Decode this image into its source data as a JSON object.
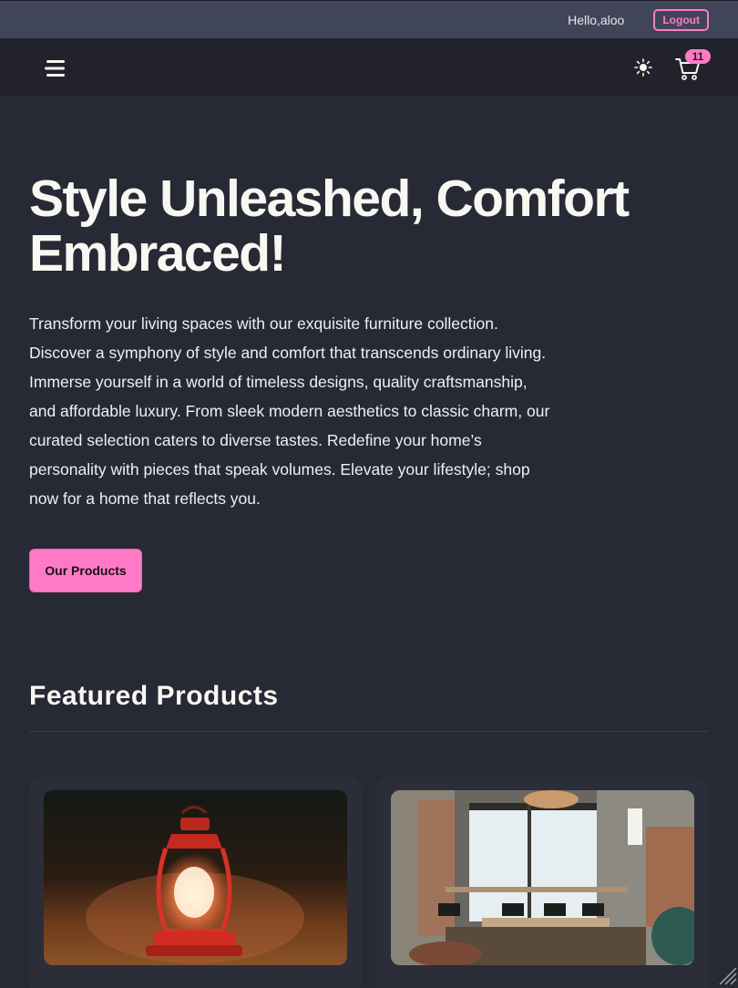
{
  "topbar": {
    "greeting": "Hello,aloo",
    "logout_label": "Logout"
  },
  "navbar": {
    "menu_icon": "hamburger-menu-icon",
    "theme_icon": "sun-icon",
    "cart_icon": "shopping-cart-icon",
    "cart_count": "11"
  },
  "hero": {
    "title": "Style Unleashed, Comfort Embraced!",
    "description": "Transform your living spaces with our exquisite furniture collection. Discover a symphony of style and comfort that transcends ordinary living. Immerse yourself in a world of timeless designs, quality craftsmanship, and affordable luxury. From sleek modern aesthetics to classic charm, our curated selection caters to diverse tastes. Redefine your home’s personality with pieces that speak volumes. Elevate your lifestyle; shop now for a home that reflects you.",
    "cta_label": "Our Products"
  },
  "featured": {
    "title": "Featured Products",
    "products": [
      {
        "image": "red-lantern-photo"
      },
      {
        "image": "cafe-interior-photo"
      }
    ]
  },
  "colors": {
    "page_bg": "#272935",
    "topbar_bg": "#414558",
    "navbar_bg": "#21222c",
    "accent": "#ff7ac6"
  }
}
